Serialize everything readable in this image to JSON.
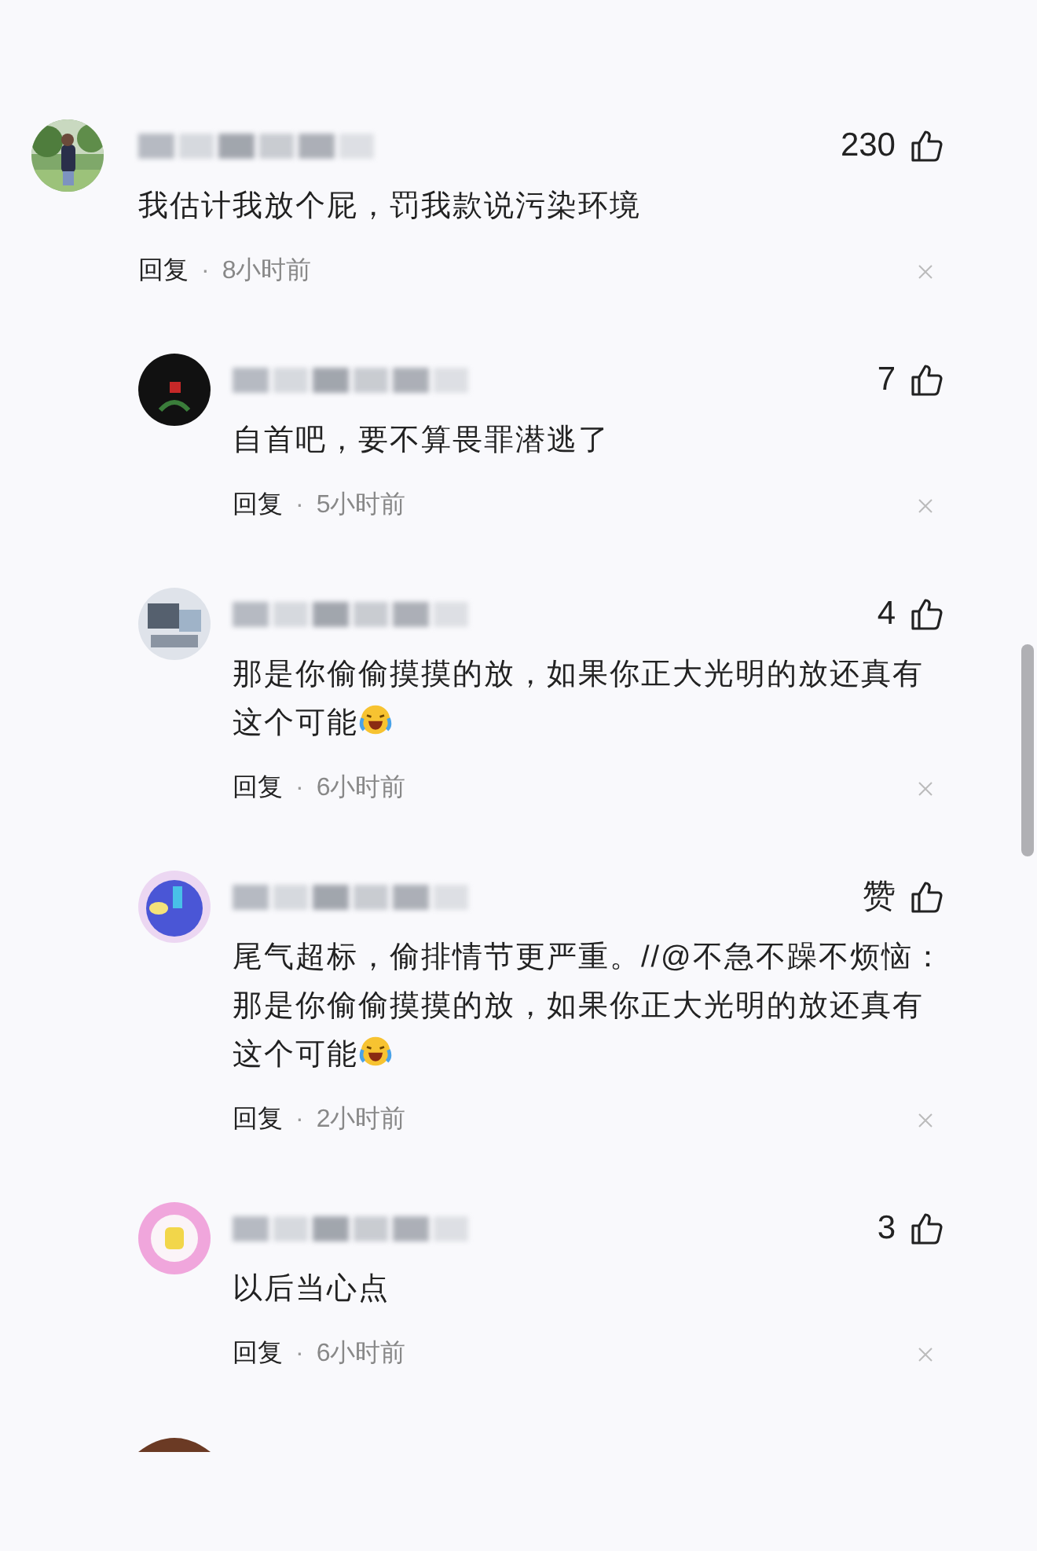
{
  "comments": [
    {
      "likes": "230",
      "body": "我估计我放个屁，罚我款说污染环境",
      "emoji": false,
      "reply": "回复",
      "dot": "·",
      "time": "8小时前",
      "reply_level": false
    },
    {
      "avatar": {
        "kind": "dark"
      },
      "likes": "7",
      "body": "自首吧，要不算畏罪潜逃了",
      "emoji": false,
      "reply": "回复",
      "dot": "·",
      "time": "5小时前",
      "reply_level": true
    },
    {
      "avatar": {
        "kind": "desk"
      },
      "likes": "4",
      "body": "那是你偷偷摸摸的放，如果你正大光明的放还真有这个可能",
      "emoji": true,
      "reply": "回复",
      "dot": "·",
      "time": "6小时前",
      "reply_level": true
    },
    {
      "avatar": {
        "kind": "purple"
      },
      "likes": "赞",
      "body": "尾气超标，偷排情节更严重。//@不急不躁不烦恼：那是你偷偷摸摸的放，如果你正大光明的放还真有这个可能",
      "emoji": true,
      "reply": "回复",
      "dot": "·",
      "time": "2小时前",
      "reply_level": true
    },
    {
      "avatar": {
        "kind": "pink"
      },
      "likes": "3",
      "body": "以后当心点",
      "emoji": false,
      "reply": "回复",
      "dot": "·",
      "time": "6小时前",
      "reply_level": true
    }
  ]
}
